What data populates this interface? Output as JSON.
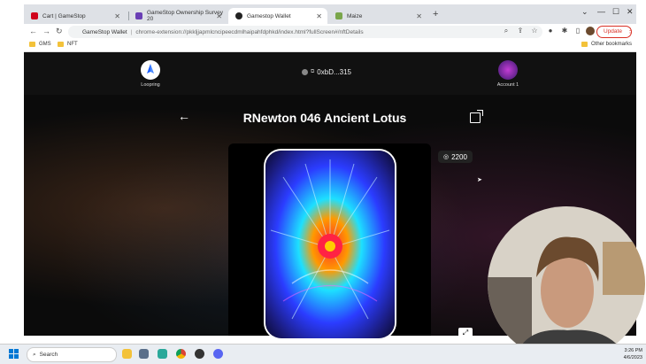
{
  "browser": {
    "tabs": [
      {
        "label": "Cart | GameStop",
        "color": "#d0021b"
      },
      {
        "label": "GameStop Ownership Survey 20",
        "color": "#6a3fb5"
      },
      {
        "label": "Gamestop Wallet",
        "color": "#222222",
        "active": true
      },
      {
        "label": "Maize",
        "color": "#7aa64b"
      }
    ],
    "url_label": "GameStop Wallet",
    "url": "chrome-extension://pkkljjapmlcncipeecdmlhaipahfdphkd/index.html?fullScreen#/nftDetails",
    "update_label": "Update",
    "bookmarks": [
      "GMS",
      "NFT"
    ],
    "other_bookmarks": "Other bookmarks"
  },
  "wallet": {
    "left_network_label": "Loopring",
    "address": "0xbD...315",
    "account_label": "Account 1"
  },
  "nft": {
    "title": "RNewton 046 Ancient Lotus",
    "count": "2200"
  },
  "taskbar": {
    "search_placeholder": "Search",
    "time": "3:26 PM",
    "date": "4/6/2023"
  }
}
